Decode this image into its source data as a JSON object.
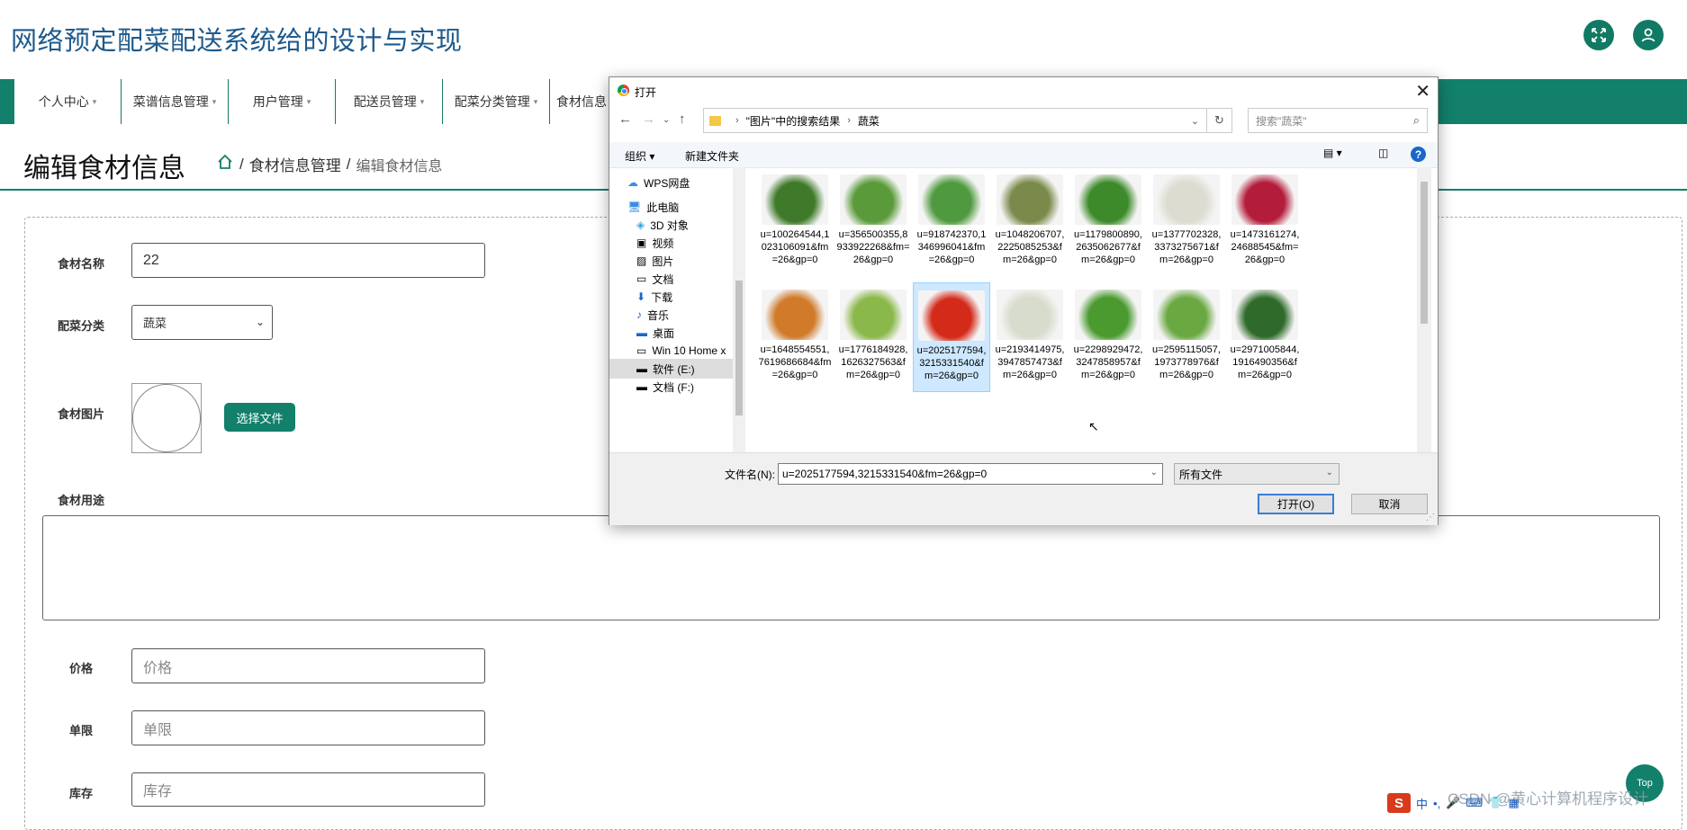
{
  "header": {
    "title": "网络预定配菜配送系统给的设计与实现"
  },
  "nav": {
    "items": [
      "个人中心",
      "菜谱信息管理",
      "用户管理",
      "配送员管理",
      "配菜分类管理",
      "食材信息"
    ]
  },
  "page": {
    "title": "编辑食材信息",
    "breadcrumb": [
      "食材信息管理",
      "编辑食材信息"
    ]
  },
  "form": {
    "name_label": "食材名称",
    "name_value": "22",
    "category_label": "配菜分类",
    "category_value": "蔬菜",
    "image_label": "食材图片",
    "choose_file": "选择文件",
    "usage_label": "食材用途",
    "price_label": "价格",
    "price_placeholder": "价格",
    "limit_label": "单限",
    "limit_placeholder": "单限",
    "stock_label": "库存",
    "stock_placeholder": "库存"
  },
  "top_button": "Top",
  "watermark": "CSDN @黄心计算机程序设计",
  "ime": {
    "logo": "S",
    "lang": "中"
  },
  "dialog": {
    "title": "打开",
    "path": [
      "\"图片\"中的搜索结果",
      "蔬菜"
    ],
    "search_placeholder": "搜索\"蔬菜\"",
    "organize": "组织 ▾",
    "new_folder": "新建文件夹",
    "sidebar": [
      {
        "label": "WPS网盘",
        "icon": "cloud-icon"
      },
      {
        "label": "此电脑",
        "icon": "computer-icon"
      },
      {
        "label": "3D 对象",
        "icon": "cube-icon"
      },
      {
        "label": "视频",
        "icon": "video-icon"
      },
      {
        "label": "图片",
        "icon": "picture-icon"
      },
      {
        "label": "文档",
        "icon": "document-icon"
      },
      {
        "label": "下载",
        "icon": "download-icon"
      },
      {
        "label": "音乐",
        "icon": "music-icon"
      },
      {
        "label": "桌面",
        "icon": "desktop-icon"
      },
      {
        "label": "Win 10 Home x",
        "icon": "drive-icon"
      },
      {
        "label": "软件 (E:)",
        "icon": "drive-icon"
      },
      {
        "label": "文档 (F:)",
        "icon": "drive-icon"
      }
    ],
    "files": [
      {
        "name": "u=100264544,1 023106091&fm =26&gp=0",
        "color": "#3f7a2a"
      },
      {
        "name": "u=356500355,8 933922268&fm= 26&gp=0",
        "color": "#5a9a3a"
      },
      {
        "name": "u=918742370,1 346996041&fm =26&gp=0",
        "color": "#4f9a3f"
      },
      {
        "name": "u=1048206707, 2225085253&f m=26&gp=0",
        "color": "#7a8a4a"
      },
      {
        "name": "u=1179800890, 2635062677&f m=26&gp=0",
        "color": "#3d8a2a"
      },
      {
        "name": "u=1377702328, 3373275671&f m=26&gp=0",
        "color": "#dcdcd0"
      },
      {
        "name": "u=1473161274, 24688545&fm= 26&gp=0",
        "color": "#b31c3a"
      },
      {
        "name": "u=1648554551, 7619686684&fm =26&gp=0",
        "color": "#d07a2a"
      },
      {
        "name": "u=1776184928, 1626327563&f m=26&gp=0",
        "color": "#8ab84a"
      },
      {
        "name": "u=2025177594, 3215331540&f m=26&gp=0",
        "color": "#d42a1a"
      },
      {
        "name": "u=2193414975, 3947857473&f m=26&gp=0",
        "color": "#d8dccc"
      },
      {
        "name": "u=2298929472, 3247858957&f m=26&gp=0",
        "color": "#4a9a2f"
      },
      {
        "name": "u=2595115057, 1973778976&f m=26&gp=0",
        "color": "#6aa842"
      },
      {
        "name": "u=2971005844, 1916490356&f m=26&gp=0",
        "color": "#2f6a2a"
      }
    ],
    "selected_index": 9,
    "filename_label": "文件名(N):",
    "filename_value": "u=2025177594,3215331540&fm=26&gp=0",
    "filetype": "所有文件",
    "open_button": "打开(O)",
    "cancel_button": "取消"
  }
}
